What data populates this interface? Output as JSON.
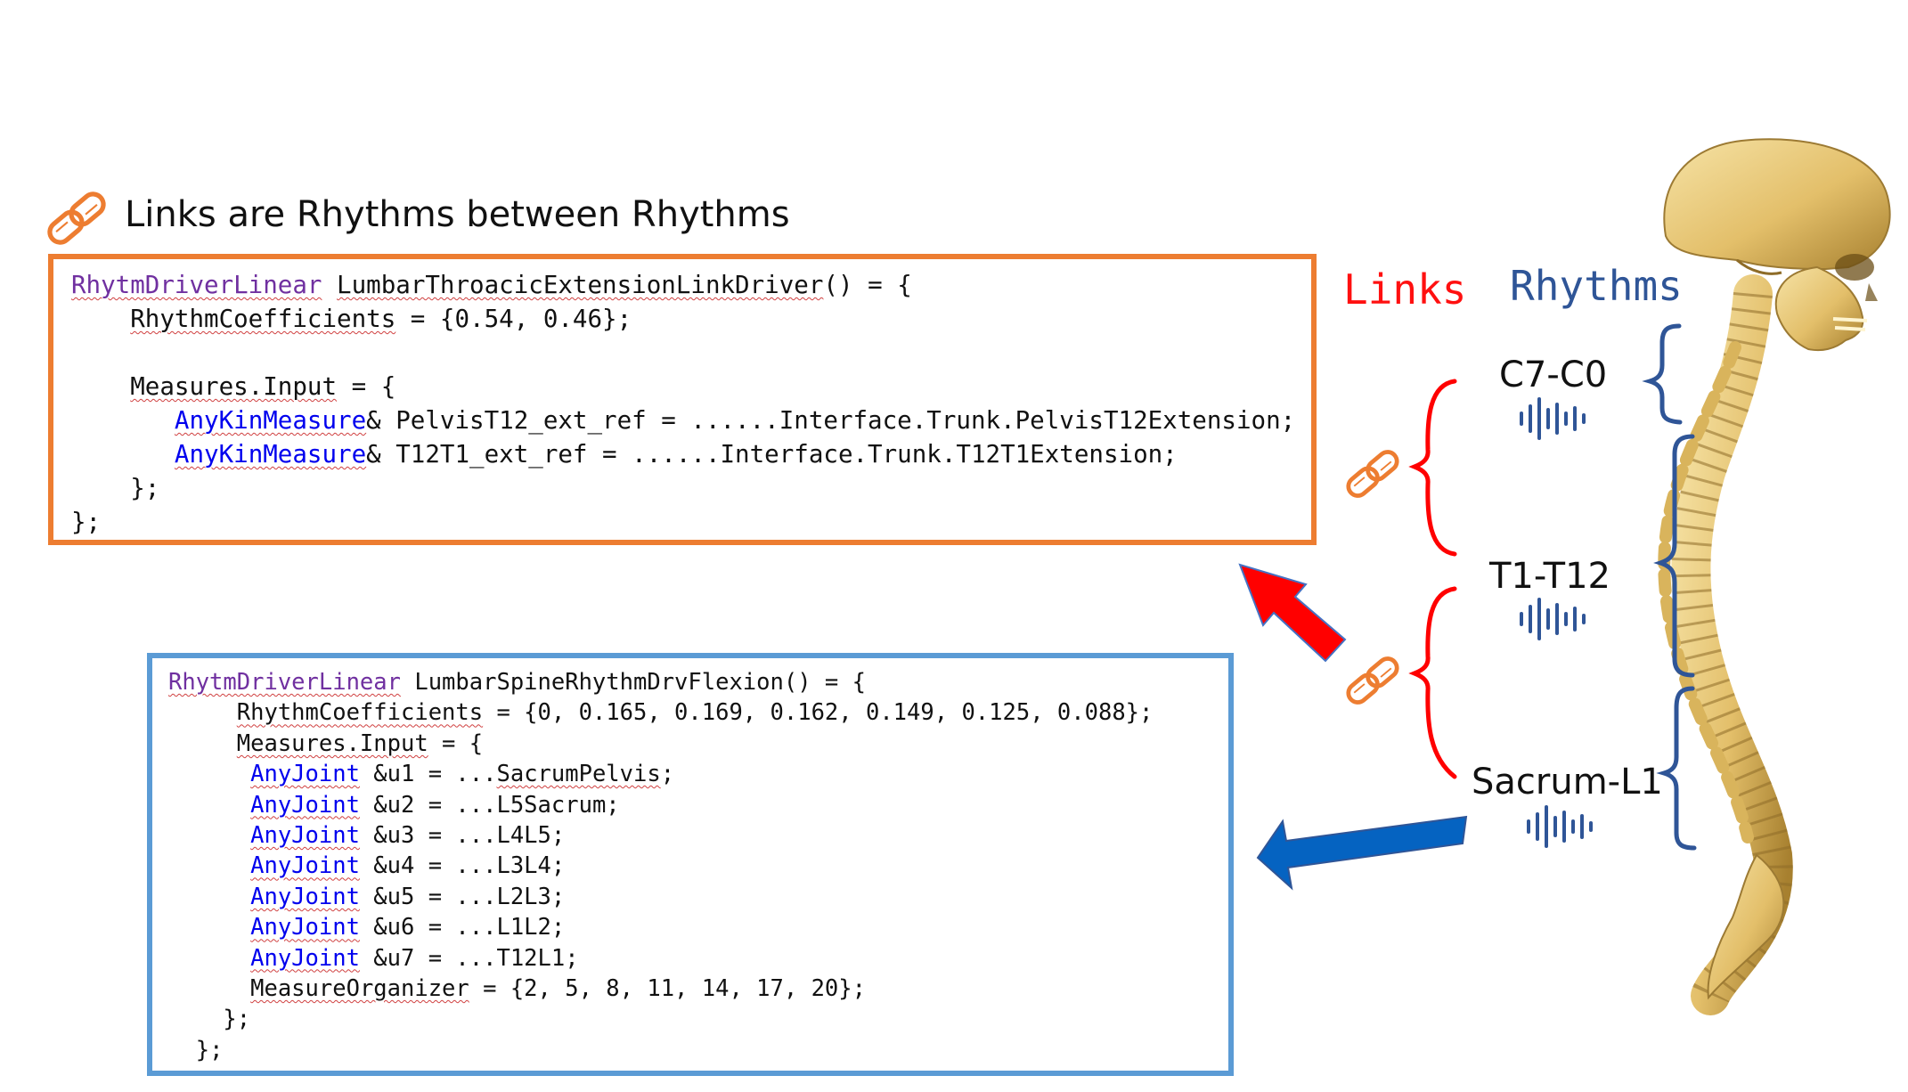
{
  "title": "Links are Rhythms between Rhythms",
  "headers": {
    "links": "Links",
    "rhythms": "Rhythms"
  },
  "segments": {
    "c7_c0": "C7-C0",
    "t1_t12": "T1-T12",
    "sacrum_l1": "Sacrum-L1"
  },
  "orange_code": {
    "line1_kw": "RhytmDriverLinear",
    "line1_name": "LumbarThroacicExtensionLinkDriver",
    "line1_rest": "() = {",
    "line2_name": "RhythmCoefficients",
    "line2_rest": " = {0.54, 0.46};",
    "line4_name": "Measures.Input",
    "line4_rest": " = {",
    "line5_type": "AnyKinMeasure",
    "line5_rest": "& PelvisT12_ext_ref = ......Interface.Trunk.PelvisT12Extension;",
    "line6_type": "AnyKinMeasure",
    "line6_rest": "& T12T1_ext_ref = ......Interface.Trunk.T12T1Extension;",
    "line7": "};",
    "line8": "};"
  },
  "blue_code": {
    "line1_kw": "RhytmDriverLinear",
    "line1_rest": " LumbarSpineRhythmDrvFlexion() = {",
    "line2_name": "RhythmCoefficients",
    "line2_rest": " = {0, 0.165, 0.169, 0.162, 0.149, 0.125, 0.088};",
    "line3_name": "Measures.Input",
    "line3_rest": " = {",
    "joints": [
      {
        "type": "AnyJoint",
        "rest": " &u1 = ...",
        "target": "SacrumPelvis",
        "end": ";"
      },
      {
        "type": "AnyJoint",
        "rest": " &u2 = ...L5Sacrum;"
      },
      {
        "type": "AnyJoint",
        "rest": " &u3 = ...L4L5;"
      },
      {
        "type": "AnyJoint",
        "rest": " &u4 = ...L3L4;"
      },
      {
        "type": "AnyJoint",
        "rest": " &u5 = ...L2L3;"
      },
      {
        "type": "AnyJoint",
        "rest": " &u6 = ...L1L2;"
      },
      {
        "type": "AnyJoint",
        "rest": " &u7 = ...T12L1;"
      }
    ],
    "organizer_name": "MeasureOrganizer",
    "organizer_rest": " = {2, 5, 8, 11, 14, 17, 20};",
    "close1": "};",
    "close2": "};"
  },
  "colors": {
    "orange": "#ED7D31",
    "blue_box": "#5B9BD5",
    "red_arrow": "#FF0000",
    "blue_arrow": "#0563C1",
    "links_red": "#FF1010",
    "rhythms_blue": "#2F5597",
    "bone": "#E8C978"
  },
  "icons": [
    "link-chain-icon",
    "sound-wave-icon",
    "skull-and-spine-image"
  ]
}
